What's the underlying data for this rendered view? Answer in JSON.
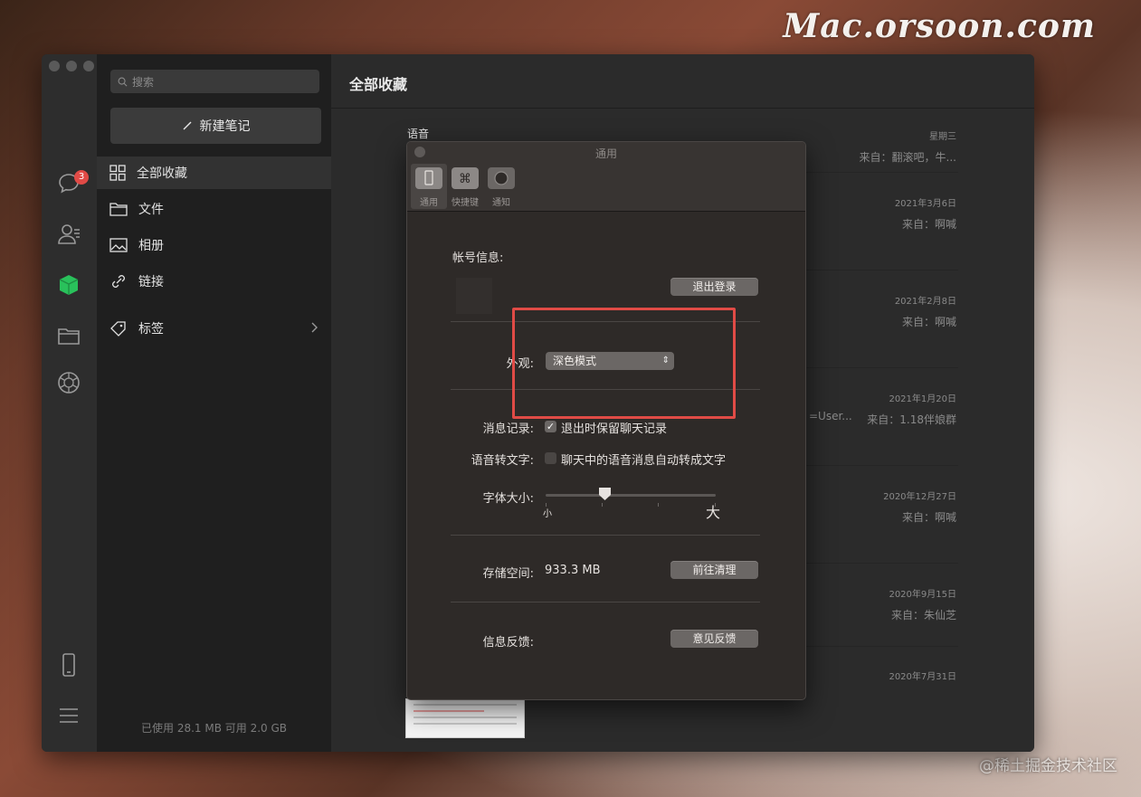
{
  "watermark_top": "Mac.orsoon.com",
  "watermark_bottom": "@稀土掘金技术社区",
  "rail": {
    "badge": "3"
  },
  "sidebar": {
    "search_placeholder": "搜索",
    "new_note": "新建笔记",
    "items": [
      {
        "label": "全部收藏",
        "icon": "grid-icon"
      },
      {
        "label": "文件",
        "icon": "folder-icon"
      },
      {
        "label": "相册",
        "icon": "image-icon"
      },
      {
        "label": "链接",
        "icon": "link-icon"
      },
      {
        "label": "标签",
        "icon": "tag-icon"
      }
    ],
    "usage": "已使用 28.1 MB 可用 2.0 GB"
  },
  "main": {
    "title": "全部收藏",
    "first_title": "语音",
    "entries": [
      {
        "date": "星期三",
        "from": "来自：翻滚吧，牛..."
      },
      {
        "date": "2021年3月6日",
        "from": "来自：啊喊"
      },
      {
        "date": "2021年2月8日",
        "from": "来自：啊喊"
      },
      {
        "date": "2021年1月20日",
        "from": "来自：1.18伴娘群"
      },
      {
        "date": "2020年12月27日",
        "from": "来自：啊喊"
      },
      {
        "date": "2020年9月15日",
        "from": "来自：朱仙芝"
      },
      {
        "date": "2020年7月31日",
        "from": ""
      }
    ],
    "truncated_text": "=User..."
  },
  "prefs": {
    "title": "通用",
    "tabs": [
      {
        "label": "通用",
        "icon": "phone-icon"
      },
      {
        "label": "快捷键",
        "icon": "command-icon"
      },
      {
        "label": "通知",
        "icon": "circle-icon"
      }
    ],
    "account_label": "帐号信息:",
    "logout": "退出登录",
    "appearance_label": "外观:",
    "appearance_value": "深色模式",
    "history_label": "消息记录:",
    "history_option": "退出时保留聊天记录",
    "history_checked": true,
    "voice_label": "语音转文字:",
    "voice_option": "聊天中的语音消息自动转成文字",
    "voice_checked": false,
    "font_label": "字体大小:",
    "font_small": "小",
    "font_big": "大",
    "font_level": 0.35,
    "storage_label": "存储空间:",
    "storage_value": "933.3 MB",
    "clean": "前往清理",
    "feedback_label": "信息反馈:",
    "feedback": "意见反馈"
  }
}
